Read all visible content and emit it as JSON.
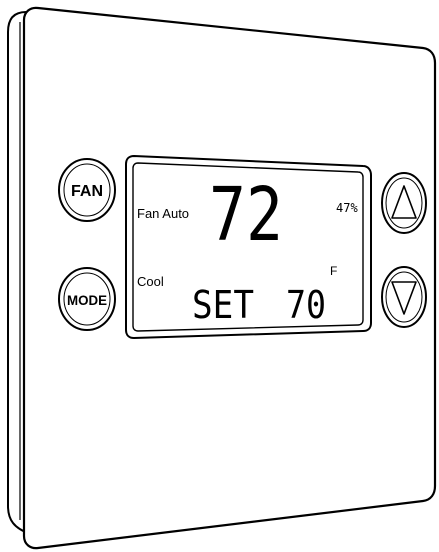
{
  "buttons": {
    "fan": "FAN",
    "mode": "MODE"
  },
  "display": {
    "fan_status": "Fan Auto",
    "temperature": "72",
    "humidity": "47%",
    "mode": "Cool",
    "unit": "F",
    "set_label": "SET",
    "setpoint": "70"
  },
  "icons": {
    "up": "up-triangle-icon",
    "down": "down-triangle-icon"
  }
}
